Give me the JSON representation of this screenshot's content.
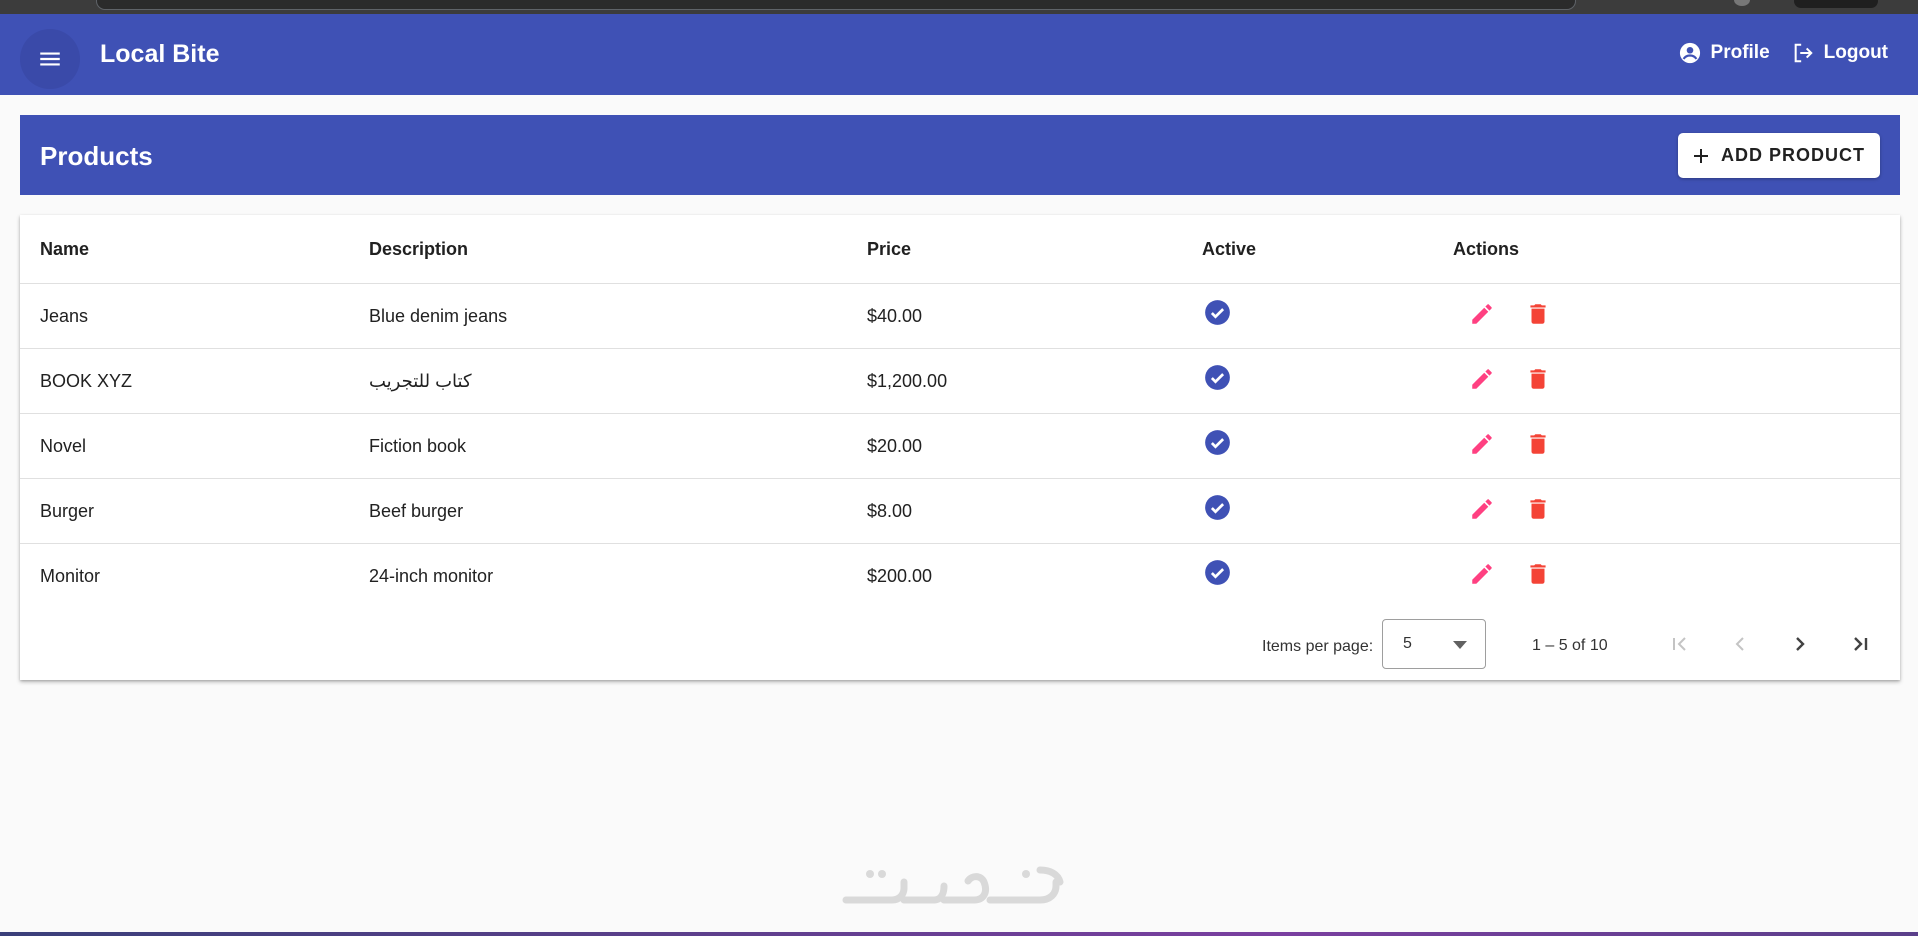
{
  "app": {
    "title": "Local Bite"
  },
  "header": {
    "profile_label": "Profile",
    "logout_label": "Logout",
    "icons": {
      "menu": "menu-icon",
      "profile": "account-circle-icon",
      "logout": "logout-icon"
    }
  },
  "page": {
    "title": "Products",
    "add_button_label": "ADD PRODUCT"
  },
  "table": {
    "columns": [
      "Name",
      "Description",
      "Price",
      "Active",
      "Actions"
    ],
    "rows": [
      {
        "name": "Jeans",
        "description": "Blue denim jeans",
        "price": "$40.00",
        "active": true
      },
      {
        "name": "BOOK XYZ",
        "description": "كتاب للتجريب",
        "price": "$1,200.00",
        "active": true
      },
      {
        "name": "Novel",
        "description": "Fiction book",
        "price": "$20.00",
        "active": true
      },
      {
        "name": "Burger",
        "description": "Beef burger",
        "price": "$8.00",
        "active": true
      },
      {
        "name": "Monitor",
        "description": "24-inch monitor",
        "price": "$200.00",
        "active": true
      }
    ]
  },
  "paginator": {
    "items_per_page_label": "Items per page:",
    "items_per_page_value": "5",
    "range_label": "1 – 5 of 10"
  },
  "colors": {
    "primary": "#3f51b5",
    "edit": "#ff4081",
    "delete": "#f44336",
    "check": "#3f51b5"
  }
}
